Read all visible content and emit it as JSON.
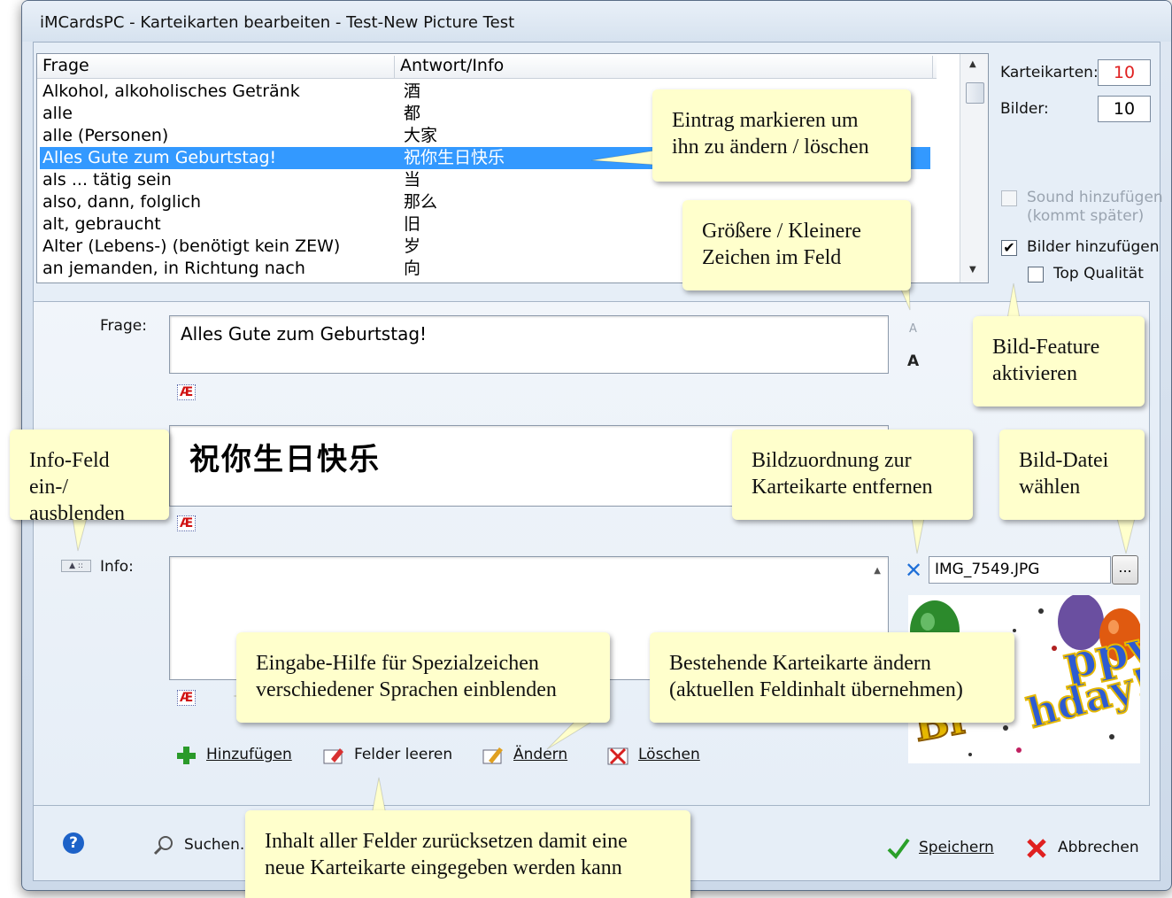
{
  "window": {
    "title": "iMCardsPC - Karteikarten bearbeiten - Test-New Picture Test"
  },
  "list": {
    "columns": [
      "Frage",
      "Antwort/Info"
    ],
    "rows": [
      {
        "q": "Alkohol, alkoholisches Getränk",
        "a": "酒"
      },
      {
        "q": "alle",
        "a": "都"
      },
      {
        "q": "alle (Personen)",
        "a": "大家"
      },
      {
        "q": "Alles Gute zum Geburtstag!",
        "a": "祝你生日快乐",
        "selected": true
      },
      {
        "q": "als ... tätig sein",
        "a": "当"
      },
      {
        "q": "also, dann, folglich",
        "a": "那么"
      },
      {
        "q": "alt, gebraucht",
        "a": "旧"
      },
      {
        "q": "Alter (Lebens-) (benötigt kein ZEW)",
        "a": "岁"
      },
      {
        "q": "an jemanden, in Richtung nach",
        "a": "向"
      }
    ]
  },
  "stats": {
    "karteikarten_label": "Karteikarten:",
    "karteikarten_value": "10",
    "bilder_label": "Bilder:",
    "bilder_value": "10"
  },
  "options": {
    "sound_label": "Sound hinzufügen",
    "sound_sub": "(kommt später)",
    "bilder_label": "Bilder hinzufügen",
    "bilder_checked": true,
    "top_label": "Top Qualität",
    "top_checked": false
  },
  "editor": {
    "frage_label": "Frage:",
    "frage_value": "Alles Gute zum Geburtstag!",
    "antwort_value": "祝你生日快乐",
    "info_label": "Info:",
    "info_value": "",
    "ae_label": "Æ",
    "font_small": "A",
    "font_large": "A"
  },
  "image": {
    "filename": "IMG_7549.JPG",
    "browse_label": "...",
    "remove_glyph": "✕"
  },
  "actions": {
    "add": "Hinzufügen",
    "clear": "Felder leeren",
    "change": "Ändern",
    "delete": "Löschen"
  },
  "footer": {
    "help": "?",
    "search": "Suchen...",
    "save": "Speichern",
    "cancel": "Abbrechen"
  },
  "callouts": {
    "mark": [
      "Eintrag markieren um",
      "ihn zu ändern / löschen"
    ],
    "size": [
      "Größere / Kleinere",
      "Zeichen im Feld"
    ],
    "picture_feature": [
      "Bild-Feature",
      "aktivieren"
    ],
    "info_toggle": [
      "Info-Feld ein-/",
      "ausblenden"
    ],
    "remove_picture": [
      "Bildzuordnung zur",
      "Karteikarte entfernen"
    ],
    "choose_file": [
      "Bild-Datei",
      "wählen"
    ],
    "special_chars": [
      "Eingabe-Hilfe für Spezialzeichen",
      "verschiedener Sprachen einblenden"
    ],
    "change_card": [
      "Bestehende Karteikarte ändern",
      "(aktuellen Feldinhalt übernehmen)"
    ],
    "reset": [
      "Inhalt aller Felder zurücksetzen damit eine",
      "neue Karteikarte eingegeben werden kann"
    ]
  },
  "colors": {
    "selection": "#3399ff",
    "callout_bg": "#ffffcc",
    "count_red": "#e02020"
  }
}
